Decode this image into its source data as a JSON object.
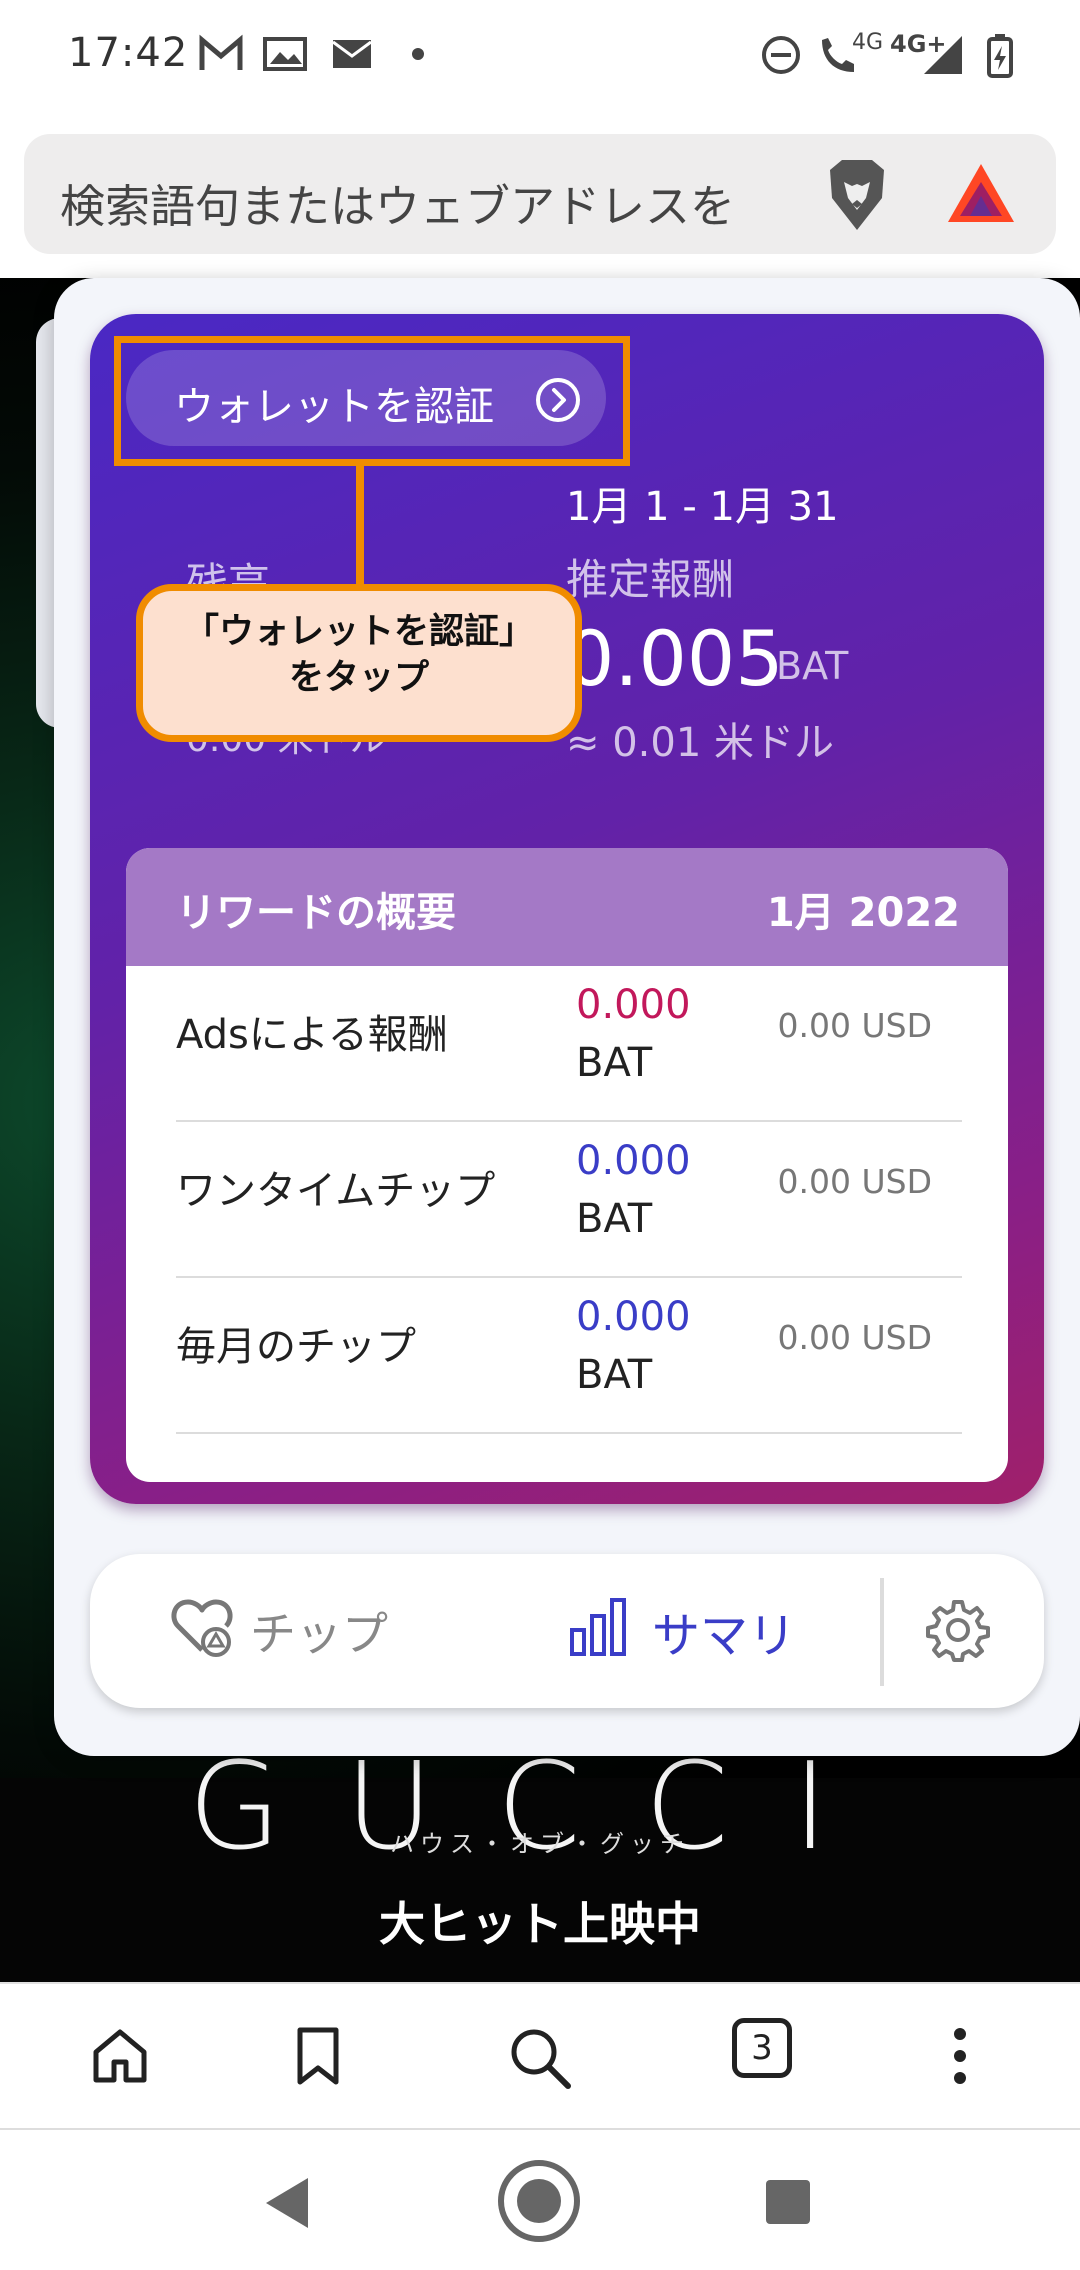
{
  "status_bar": {
    "time": "17:42",
    "icons": [
      "gmail-icon",
      "gallery-icon",
      "mail-icon",
      "dot-icon",
      "dnd-icon",
      "wifi-call-icon",
      "signal-icon",
      "battery-icon"
    ],
    "network_1": "4G",
    "network_2": "4G+"
  },
  "url_bar": {
    "placeholder": "検索語句またはウェブアドレスを"
  },
  "rewards": {
    "verify_button": "ウォレットを認証",
    "date_range": "1月 1 - 1月 31",
    "balance_label": "残高",
    "balance_usd": "0.00 米ドル",
    "estimated_label": "推定報酬",
    "estimated_value": "0.005",
    "estimated_unit": "BAT",
    "estimated_usd": "≈ 0.01 米ドル",
    "summary": {
      "title": "リワードの概要",
      "month": "1月 2022",
      "rows": [
        {
          "label": "Adsによる報酬",
          "bat": "0.000",
          "unit": "BAT",
          "usd": "0.00 USD",
          "color": "#c2185b"
        },
        {
          "label": "ワンタイムチップ",
          "bat": "0.000",
          "unit": "BAT",
          "usd": "0.00 USD",
          "color": "#3a3dc7"
        },
        {
          "label": "毎月のチップ",
          "bat": "0.000",
          "unit": "BAT",
          "usd": "0.00 USD",
          "color": "#3a3dc7"
        }
      ]
    },
    "tabs": {
      "tips": "チップ",
      "summary": "サマリ"
    }
  },
  "overlay": {
    "callout_line1": "「ウォレットを認証」",
    "callout_line2": "をタップ",
    "accent": "#f08c00"
  },
  "page": {
    "brand": "GUCCI",
    "subtitle": "ハウス・オブ・グッチ",
    "tagline": "大ヒット上映中"
  },
  "toolbar": {
    "tab_count": "3"
  },
  "colors": {
    "card_start": "#4a28c4",
    "card_end": "#a0206a",
    "accent_blue": "#3a3dc7"
  }
}
